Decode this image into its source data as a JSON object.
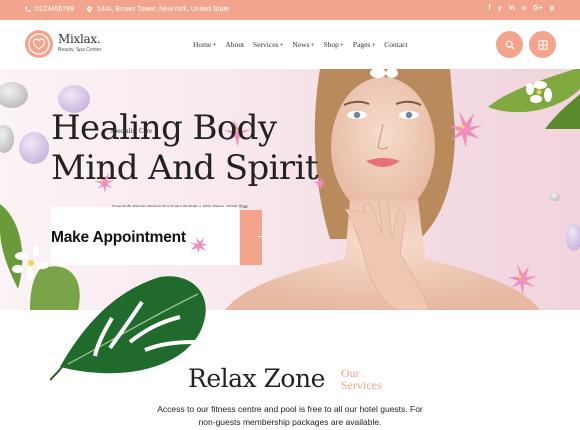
{
  "topbar": {
    "phone": "0123456789",
    "address": "14/A, Brown Tower, NewYork, United State",
    "social": [
      "f",
      "y",
      "in",
      "o",
      "G+",
      "p"
    ]
  },
  "header": {
    "logo_name": "Mixlax.",
    "logo_tagline": "Beauty, Spa Center",
    "nav": [
      {
        "label": "Home",
        "has_submenu": true
      },
      {
        "label": "About",
        "has_submenu": false
      },
      {
        "label": "Services",
        "has_submenu": true
      },
      {
        "label": "News",
        "has_submenu": true
      },
      {
        "label": "Shop",
        "has_submenu": true
      },
      {
        "label": "Pages",
        "has_submenu": true
      },
      {
        "label": "Contact",
        "has_submenu": false
      }
    ],
    "search_icon": "search-icon",
    "menu_icon": "grid-icon"
  },
  "hero": {
    "title_line1": "Healing Body",
    "title_line2": "Mind And Spirit",
    "overlay_text": "Specialist Care",
    "small_text": "Overnight Beauty Repair For Every Budget + Skin Detox, Drink That",
    "cta_label": "Make Appointment"
  },
  "relax": {
    "title": "Relax Zone",
    "subtitle_line1": "Our",
    "subtitle_line2": "Services",
    "description": "Access to our fitness centre and pool is free to all our hotel guests. For non-guests membership packages are available."
  },
  "colors": {
    "accent": "#f2a58c",
    "text_dark": "#222222"
  }
}
